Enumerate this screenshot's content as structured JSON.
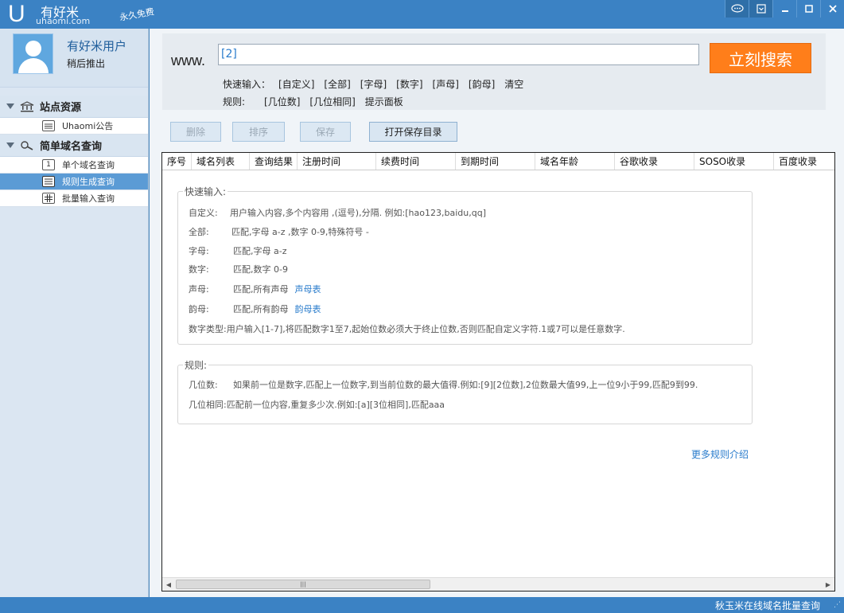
{
  "app": {
    "logo_letter": "U",
    "logo_name": "有好米",
    "logo_domain": "uhaomi.com",
    "logo_tagline": "永久免费"
  },
  "window_controls": {
    "chat": "chat-icon",
    "menu": "menu-icon",
    "minimize": "minimize-icon",
    "maximize": "maximize-icon",
    "close": "close-icon"
  },
  "user": {
    "name": "有好米用户",
    "subtitle": "稍后推出"
  },
  "sidebar": {
    "groups": [
      {
        "label": "站点资源",
        "icon": "bank-icon",
        "items": [
          {
            "label": "Uhaomi公告",
            "icon": "calendar-icon",
            "active": false
          }
        ]
      },
      {
        "label": "简单域名查询",
        "icon": "search-icon",
        "items": [
          {
            "label": "单个域名查询",
            "icon": "one-icon",
            "badge": "1",
            "active": false
          },
          {
            "label": "规则生成查询",
            "icon": "list-icon",
            "active": true
          },
          {
            "label": "批量输入查询",
            "icon": "grid-icon",
            "active": false
          }
        ]
      }
    ]
  },
  "search": {
    "prefix": "www.",
    "value": "[2]",
    "button": "立刻搜索"
  },
  "quick_input": {
    "label": "快速输入：",
    "items": [
      "[自定义]",
      "[全部]",
      "[字母]",
      "[数字]",
      "[声母]",
      "[韵母]",
      "清空"
    ]
  },
  "rules": {
    "label": "规则:",
    "items": [
      "[几位数]",
      "[几位相同]",
      "提示面板"
    ]
  },
  "toolbar": {
    "delete": "删除",
    "sort": "排序",
    "save": "保存",
    "open_dir": "打开保存目录"
  },
  "table": {
    "columns": [
      "序号",
      "域名列表",
      "查询结果",
      "注册时间",
      "续费时间",
      "到期时间",
      "域名年龄",
      "谷歌收录",
      "SOSO收录",
      "百度收录"
    ]
  },
  "help": {
    "quick_legend": "快速输入:",
    "quick_lines": [
      {
        "label": "自定义:",
        "text": "用户输入内容,多个内容用 ,(逗号),分隔. 例如:[hao123,baidu,qq]"
      },
      {
        "label": "全部:",
        "text": "匹配,字母 a-z ,数字 0-9,特殊符号 -"
      },
      {
        "label": "字母:",
        "text": "匹配,字母 a-z"
      },
      {
        "label": "数字:",
        "text": "匹配,数字 0-9"
      },
      {
        "label": "声母:",
        "text": "匹配,所有声母",
        "link": "声母表"
      },
      {
        "label": "韵母:",
        "text": "匹配,所有韵母",
        "link": "韵母表"
      },
      {
        "label": "数字类型:",
        "text": "用户输入[1-7],将匹配数字1至7,起始位数必须大于终止位数,否则匹配自定义字符.1或7可以是任意数字."
      }
    ],
    "rules_legend": "规则:",
    "rule_lines": [
      {
        "label": "几位数:",
        "text": "如果前一位是数字,匹配上一位数字,到当前位数的最大值得.例如:[9][2位数],2位数最大值99,上一位9小于99,匹配9到99."
      },
      {
        "label": "几位相同:",
        "text": "匹配前一位内容,重复多少次.例如:[a][3位相同],匹配aaa"
      }
    ],
    "more": "更多规则介绍"
  },
  "status": {
    "text": "秋玉米在线域名批量查询"
  }
}
